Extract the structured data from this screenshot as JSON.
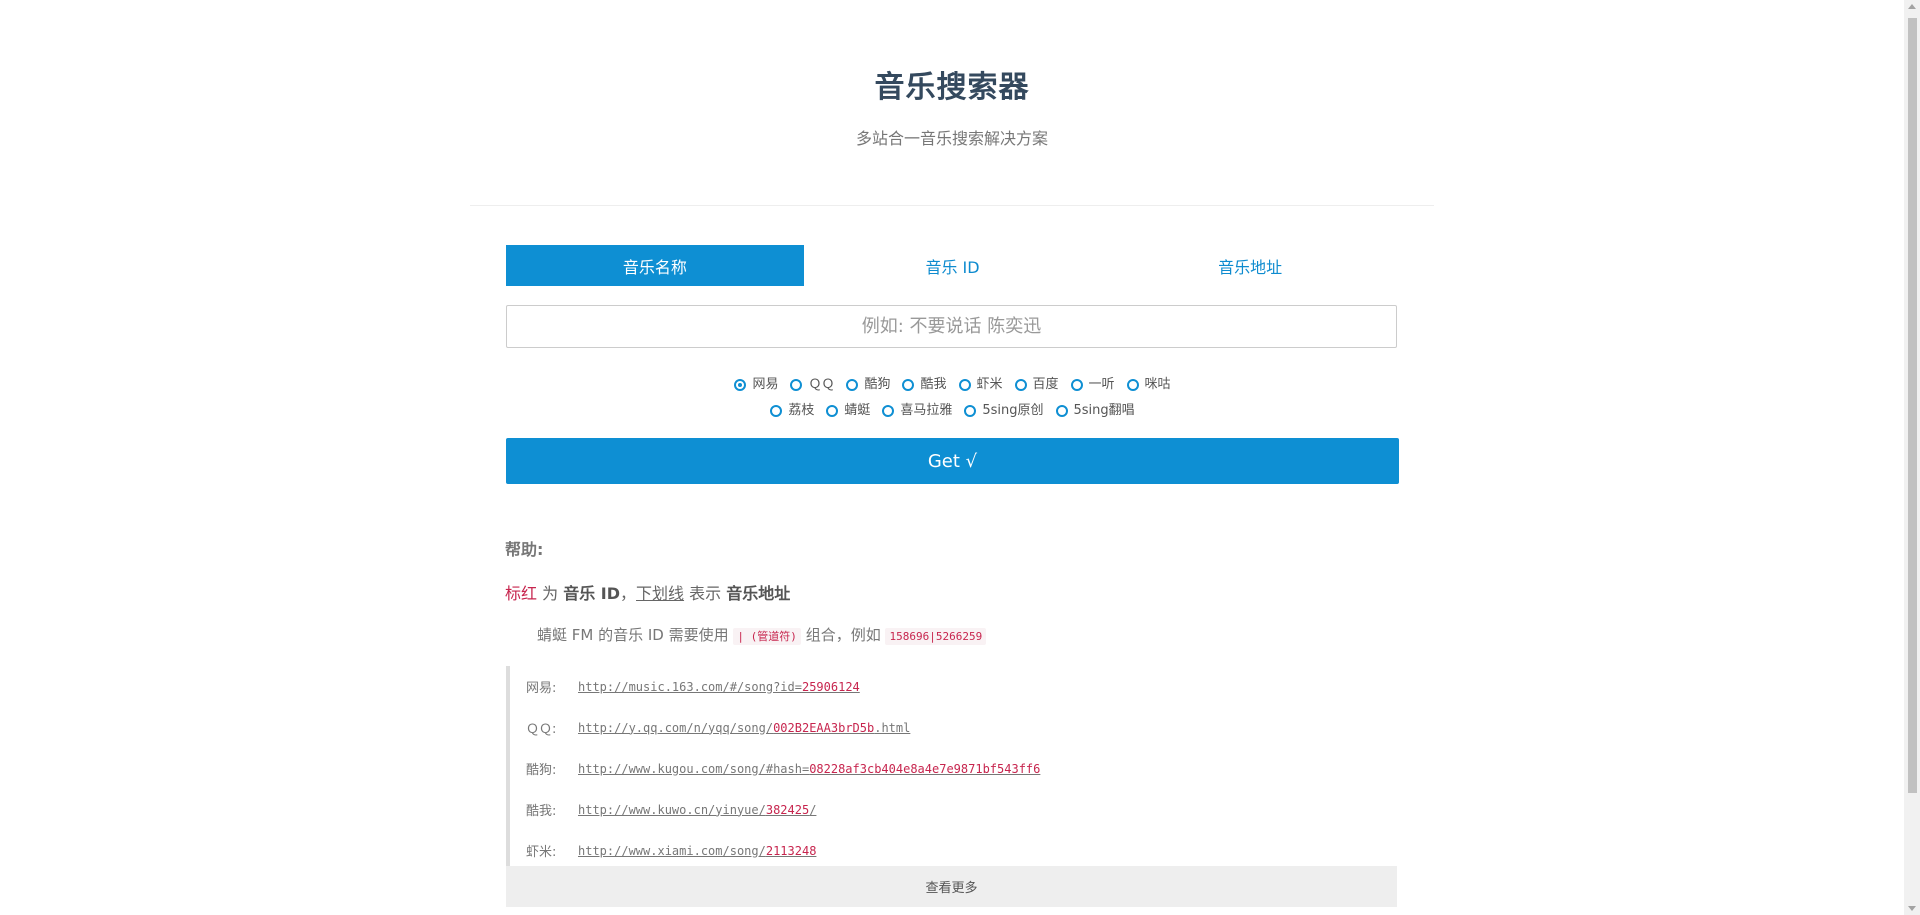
{
  "header": {
    "title": "音乐搜索器",
    "subtitle": "多站合一音乐搜索解决方案"
  },
  "tabs": [
    {
      "label": "音乐名称",
      "active": true
    },
    {
      "label": "音乐 ID",
      "active": false
    },
    {
      "label": "音乐地址",
      "active": false
    }
  ],
  "search": {
    "placeholder": "例如: 不要说话 陈奕迅",
    "value": ""
  },
  "sources": {
    "row1": [
      "网易",
      "ＱＱ",
      "酷狗",
      "酷我",
      "虾米",
      "百度",
      "一听",
      "咪咕"
    ],
    "row2": [
      "荔枝",
      "蜻蜓",
      "喜马拉雅",
      "5sing原创",
      "5sing翻唱"
    ],
    "selected": "网易"
  },
  "get_button": "Get √",
  "help": {
    "title": "帮助:",
    "red_word": "标红",
    "is": " 为 ",
    "music_id": "音乐 ID",
    "comma": "，",
    "underline_word": "下划线",
    "means": " 表示 ",
    "music_url": "音乐地址",
    "qingting_prefix": "蜻蜓 FM 的音乐 ID 需要使用",
    "pipe_code": "| (管道符)",
    "qingting_mid": "组合，例如",
    "qingting_example": "158696|5266259"
  },
  "examples": [
    {
      "label": "网易:",
      "url_prefix": "http://music.163.com/#/song?id=",
      "id": "25906124"
    },
    {
      "label": "ＱＱ:",
      "url_prefix": "http://y.qq.com/n/yqq/song/",
      "id": "002B2EAA3brD5b",
      "url_suffix": ".html"
    },
    {
      "label": "酷狗:",
      "url_prefix": "http://www.kugou.com/song/#hash=",
      "id": "08228af3cb404e8a4e7e9871bf543ff6"
    },
    {
      "label": "酷我:",
      "url_prefix": "http://www.kuwo.cn/yinyue/",
      "id": "382425",
      "url_suffix": "/"
    },
    {
      "label": "虾米:",
      "url_prefix": "http://www.xiami.com/song/",
      "id": "2113248"
    }
  ],
  "more_button": "查看更多",
  "colors": {
    "accent": "#0e8fd3",
    "highlight": "#c7254e"
  }
}
